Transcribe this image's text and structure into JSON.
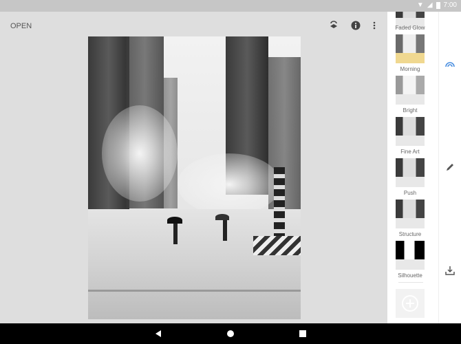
{
  "status_bar": {
    "time": "7:00"
  },
  "toolbar": {
    "open_label": "OPEN",
    "icons": [
      "stack-edit-icon",
      "info-icon",
      "more-vert-icon"
    ]
  },
  "looks": [
    {
      "label": "Faded Glow"
    },
    {
      "label": "Morning"
    },
    {
      "label": "Bright"
    },
    {
      "label": "Fine Art"
    },
    {
      "label": "Push"
    },
    {
      "label": "Structure"
    },
    {
      "label": "Silhouette"
    }
  ],
  "rail": {
    "icons": [
      "looks-icon",
      "edit-icon",
      "export-icon"
    ],
    "accent": "#4a8fe0"
  },
  "nav": {
    "icons": [
      "back-icon",
      "home-icon",
      "recents-icon"
    ]
  }
}
